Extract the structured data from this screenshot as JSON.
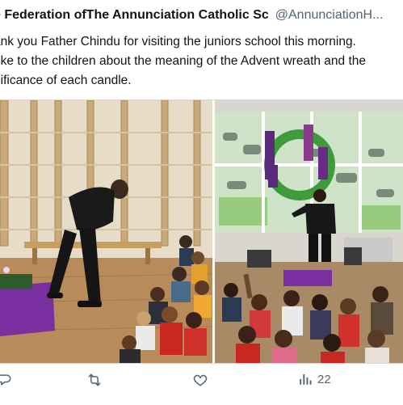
{
  "header": {
    "display_name": "e Federation ofThe Annunciation Catholic Sc",
    "handle": "@AnnunciationH..."
  },
  "tweet": {
    "lines": [
      "ank you Father Chindu for visiting the juniors school this morning.",
      "oke to the children about the meaning of the Advent wreath and the",
      "nificance of each candle."
    ]
  },
  "media": {
    "left_photo": "hall-talk-photo",
    "right_photo": "advent-wreath-display-photo"
  },
  "actions": {
    "reply_icon": "reply-icon",
    "retweet_icon": "retweet-icon",
    "like_icon": "heart-icon",
    "views_icon": "views-chart-icon",
    "views_count": "22"
  },
  "colors": {
    "text": "#0f1419",
    "muted": "#536471",
    "border": "#cfd9de"
  }
}
